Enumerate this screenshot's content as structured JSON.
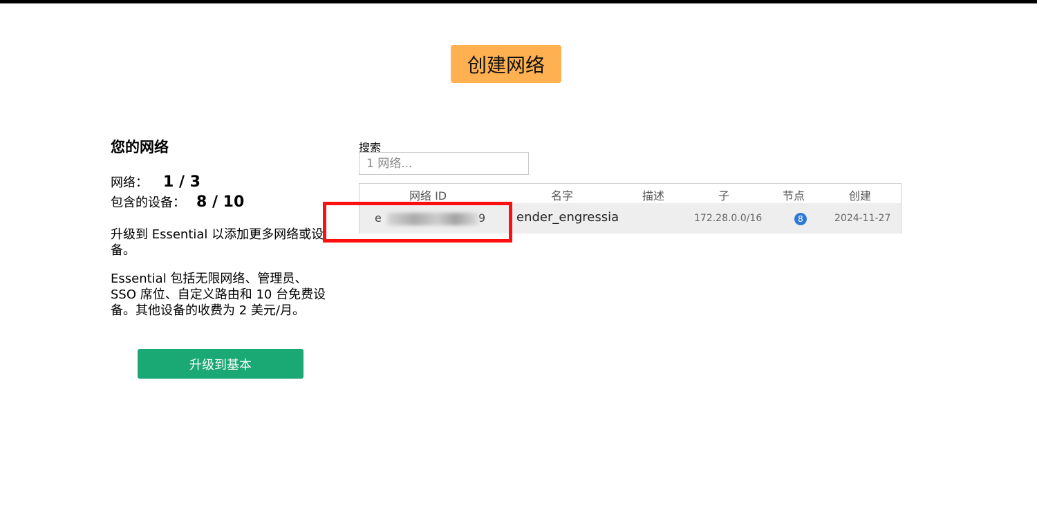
{
  "header": {
    "create_button_label": "创建网络"
  },
  "sidebar": {
    "title": "您的网络",
    "networks_label": "网络：",
    "networks_value": "1 / 3",
    "devices_label": "包含的设备：",
    "devices_value": "8 / 10",
    "upgrade_note": "升级到 Essential 以添加更多网络或设备。",
    "essential_desc": "Essential 包括无限网络、管理员、SSO 席位、自定义路由和 10 台免费设备。其他设备的收费为 2 美元/月。",
    "upgrade_button_label": "升级到基本"
  },
  "search": {
    "label": "搜索",
    "placeholder": "1 网络..."
  },
  "table": {
    "columns": [
      "网络 ID",
      "名字",
      "描述",
      "子",
      "节点",
      "创建"
    ],
    "rows": [
      {
        "network_id_visible": "e",
        "network_id_tail": "9",
        "name": "ender_engressia",
        "description": "",
        "subnet": "172.28.0.0/16",
        "nodes": "8",
        "created": "2024-11-27"
      }
    ]
  },
  "colors": {
    "create_button": "#ffb050",
    "upgrade_button": "#1aa874",
    "node_badge": "#2d7ad6",
    "highlight_box": "#ff1010"
  }
}
